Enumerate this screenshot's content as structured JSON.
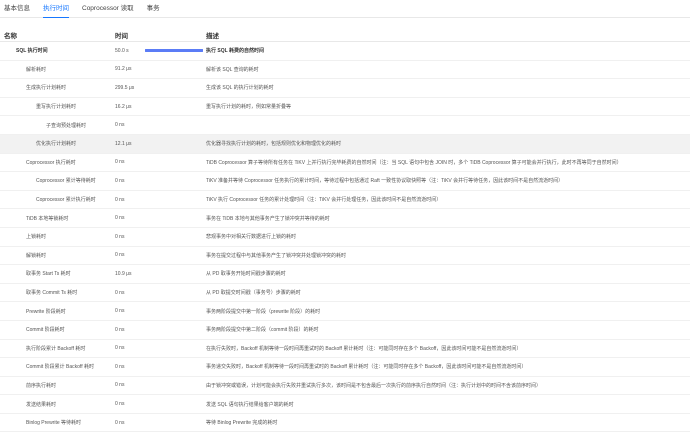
{
  "tabs": [
    {
      "label": "基本信息",
      "active": false
    },
    {
      "label": "执行时间",
      "active": true
    },
    {
      "label": "Coprocessor 读取",
      "active": false
    },
    {
      "label": "事务",
      "active": false
    }
  ],
  "table": {
    "headers": {
      "name": "名称",
      "time": "时间",
      "desc": "描述"
    },
    "rows": [
      {
        "name": "SQL 执行时间",
        "indent": 0,
        "time": "50.0 s",
        "fraction": 1.0,
        "desc": "执行 SQL 耗费的自然时间",
        "bold": true,
        "highlight": false
      },
      {
        "name": "解析耗时",
        "indent": 1,
        "time": "91.2 μs",
        "fraction": 0,
        "desc": "解析该 SQL 查询的耗时",
        "bold": false,
        "highlight": false
      },
      {
        "name": "生成执行计划耗时",
        "indent": 1,
        "time": "299.5 μs",
        "fraction": 0,
        "desc": "生成该 SQL 的执行计划的耗时",
        "bold": false,
        "highlight": false
      },
      {
        "name": "重写执行计划耗时",
        "indent": 2,
        "time": "16.2 μs",
        "fraction": 0,
        "desc": "重写执行计划的耗时，例如常量折叠等",
        "bold": false,
        "highlight": false
      },
      {
        "name": "子查询预处理耗时",
        "indent": 3,
        "time": "0 ns",
        "fraction": 0,
        "desc": "",
        "bold": false,
        "highlight": false
      },
      {
        "name": "优化执行计划耗时",
        "indent": 2,
        "time": "12.1 μs",
        "fraction": 0,
        "desc": "优化器寻找执行计划的耗时，包括规则优化和物理优化的耗时",
        "bold": false,
        "highlight": true
      },
      {
        "name": "Coprocessor 执行耗时",
        "indent": 1,
        "time": "0 ns",
        "fraction": 0,
        "desc": "TiDB Coprocessor 算子等待所有任务在 TiKV 上并行执行完毕耗费的自然时间（注：当 SQL 语句中包含 JOIN 时，多个 TiDB Coprocessor 算子可能会并行执行，此时不再等同于自然时间）",
        "bold": false,
        "highlight": false
      },
      {
        "name": "Coprocessor 累计等待耗时",
        "indent": 2,
        "time": "0 ns",
        "fraction": 0,
        "desc": "TiKV 准备并等待 Coprocessor 任务执行的累计时间，等待过程中包括通过 Raft 一致性协议取快照等（注：TiKV 会并行等待任务，因此该时间不是自然流逝时间）",
        "bold": false,
        "highlight": false
      },
      {
        "name": "Coprocessor 累计执行耗时",
        "indent": 2,
        "time": "0 ns",
        "fraction": 0,
        "desc": "TiKV 执行 Coprocessor 任务的累计处理时间（注：TiKV 会并行处理任务，因此该时间不是自然流逝时间）",
        "bold": false,
        "highlight": false
      },
      {
        "name": "TiDB 本地等锁耗时",
        "indent": 1,
        "time": "0 ns",
        "fraction": 0,
        "desc": "事务在 TiDB 本地与其他事务产生了锁冲突并等待的耗时",
        "bold": false,
        "highlight": false
      },
      {
        "name": "上锁耗时",
        "indent": 1,
        "time": "0 ns",
        "fraction": 0,
        "desc": "悲观事务中对相关行数据进行上锁的耗时",
        "bold": false,
        "highlight": false
      },
      {
        "name": "解锁耗时",
        "indent": 1,
        "time": "0 ns",
        "fraction": 0,
        "desc": "事务在提交过程中与其他事务产生了锁冲突并处理锁冲突的耗时",
        "bold": false,
        "highlight": false
      },
      {
        "name": "取事务 Start Ts 耗时",
        "indent": 1,
        "time": "10.9 μs",
        "fraction": 0,
        "desc": "从 PD 取事务开始时间戳步骤的耗时",
        "bold": false,
        "highlight": false
      },
      {
        "name": "取事务 Commit Ts 耗时",
        "indent": 1,
        "time": "0 ns",
        "fraction": 0,
        "desc": "从 PD 取提交时间戳（事务号）步骤的耗时",
        "bold": false,
        "highlight": false
      },
      {
        "name": "Prewrite 阶段耗时",
        "indent": 1,
        "time": "0 ns",
        "fraction": 0,
        "desc": "事务两阶段提交中第一阶段（prewrite 阶段）的耗时",
        "bold": false,
        "highlight": false
      },
      {
        "name": "Commit 阶段耗时",
        "indent": 1,
        "time": "0 ns",
        "fraction": 0,
        "desc": "事务两阶段提交中第二阶段（commit 阶段）的耗时",
        "bold": false,
        "highlight": false
      },
      {
        "name": "执行阶段累计 Backoff 耗时",
        "indent": 1,
        "time": "0 ns",
        "fraction": 0,
        "desc": "在执行失败时，Backoff 机制等待一段时间再重试时的 Backoff 累计耗时（注：可能同时存在多个 Backoff，因此该时间可能不是自然流逝时间）",
        "bold": false,
        "highlight": false
      },
      {
        "name": "Commit 阶段累计 Backoff 耗时",
        "indent": 1,
        "time": "0 ns",
        "fraction": 0,
        "desc": "事务递交失败时，Backoff 机制等待一段时间再重试时的 Backoff 累计耗时（注：可能同时存在多个 Backoff，因此该时间可能不是自然流逝时间）",
        "bold": false,
        "highlight": false
      },
      {
        "name": "前序执行耗时",
        "indent": 1,
        "time": "0 ns",
        "fraction": 0,
        "desc": "由于锁冲突或错误，计划可能会执行失败并重试执行多次，该时间是不包含最后一次执行的前序执行自然时间（注：执行计划中的时间不含该前序时间）",
        "bold": false,
        "highlight": false
      },
      {
        "name": "发送结果耗时",
        "indent": 1,
        "time": "0 ns",
        "fraction": 0,
        "desc": "发送 SQL 语句执行结果给客户端的耗时",
        "bold": false,
        "highlight": false
      },
      {
        "name": "Binlog Prewrite 等待耗时",
        "indent": 1,
        "time": "0 ns",
        "fraction": 0,
        "desc": "等待 Binlog Prewrite 完成的耗时",
        "bold": false,
        "highlight": false
      }
    ]
  },
  "colors": {
    "accent": "#1677ff",
    "bar": "#5b7cf6",
    "highlight": "#f2f2f2"
  }
}
